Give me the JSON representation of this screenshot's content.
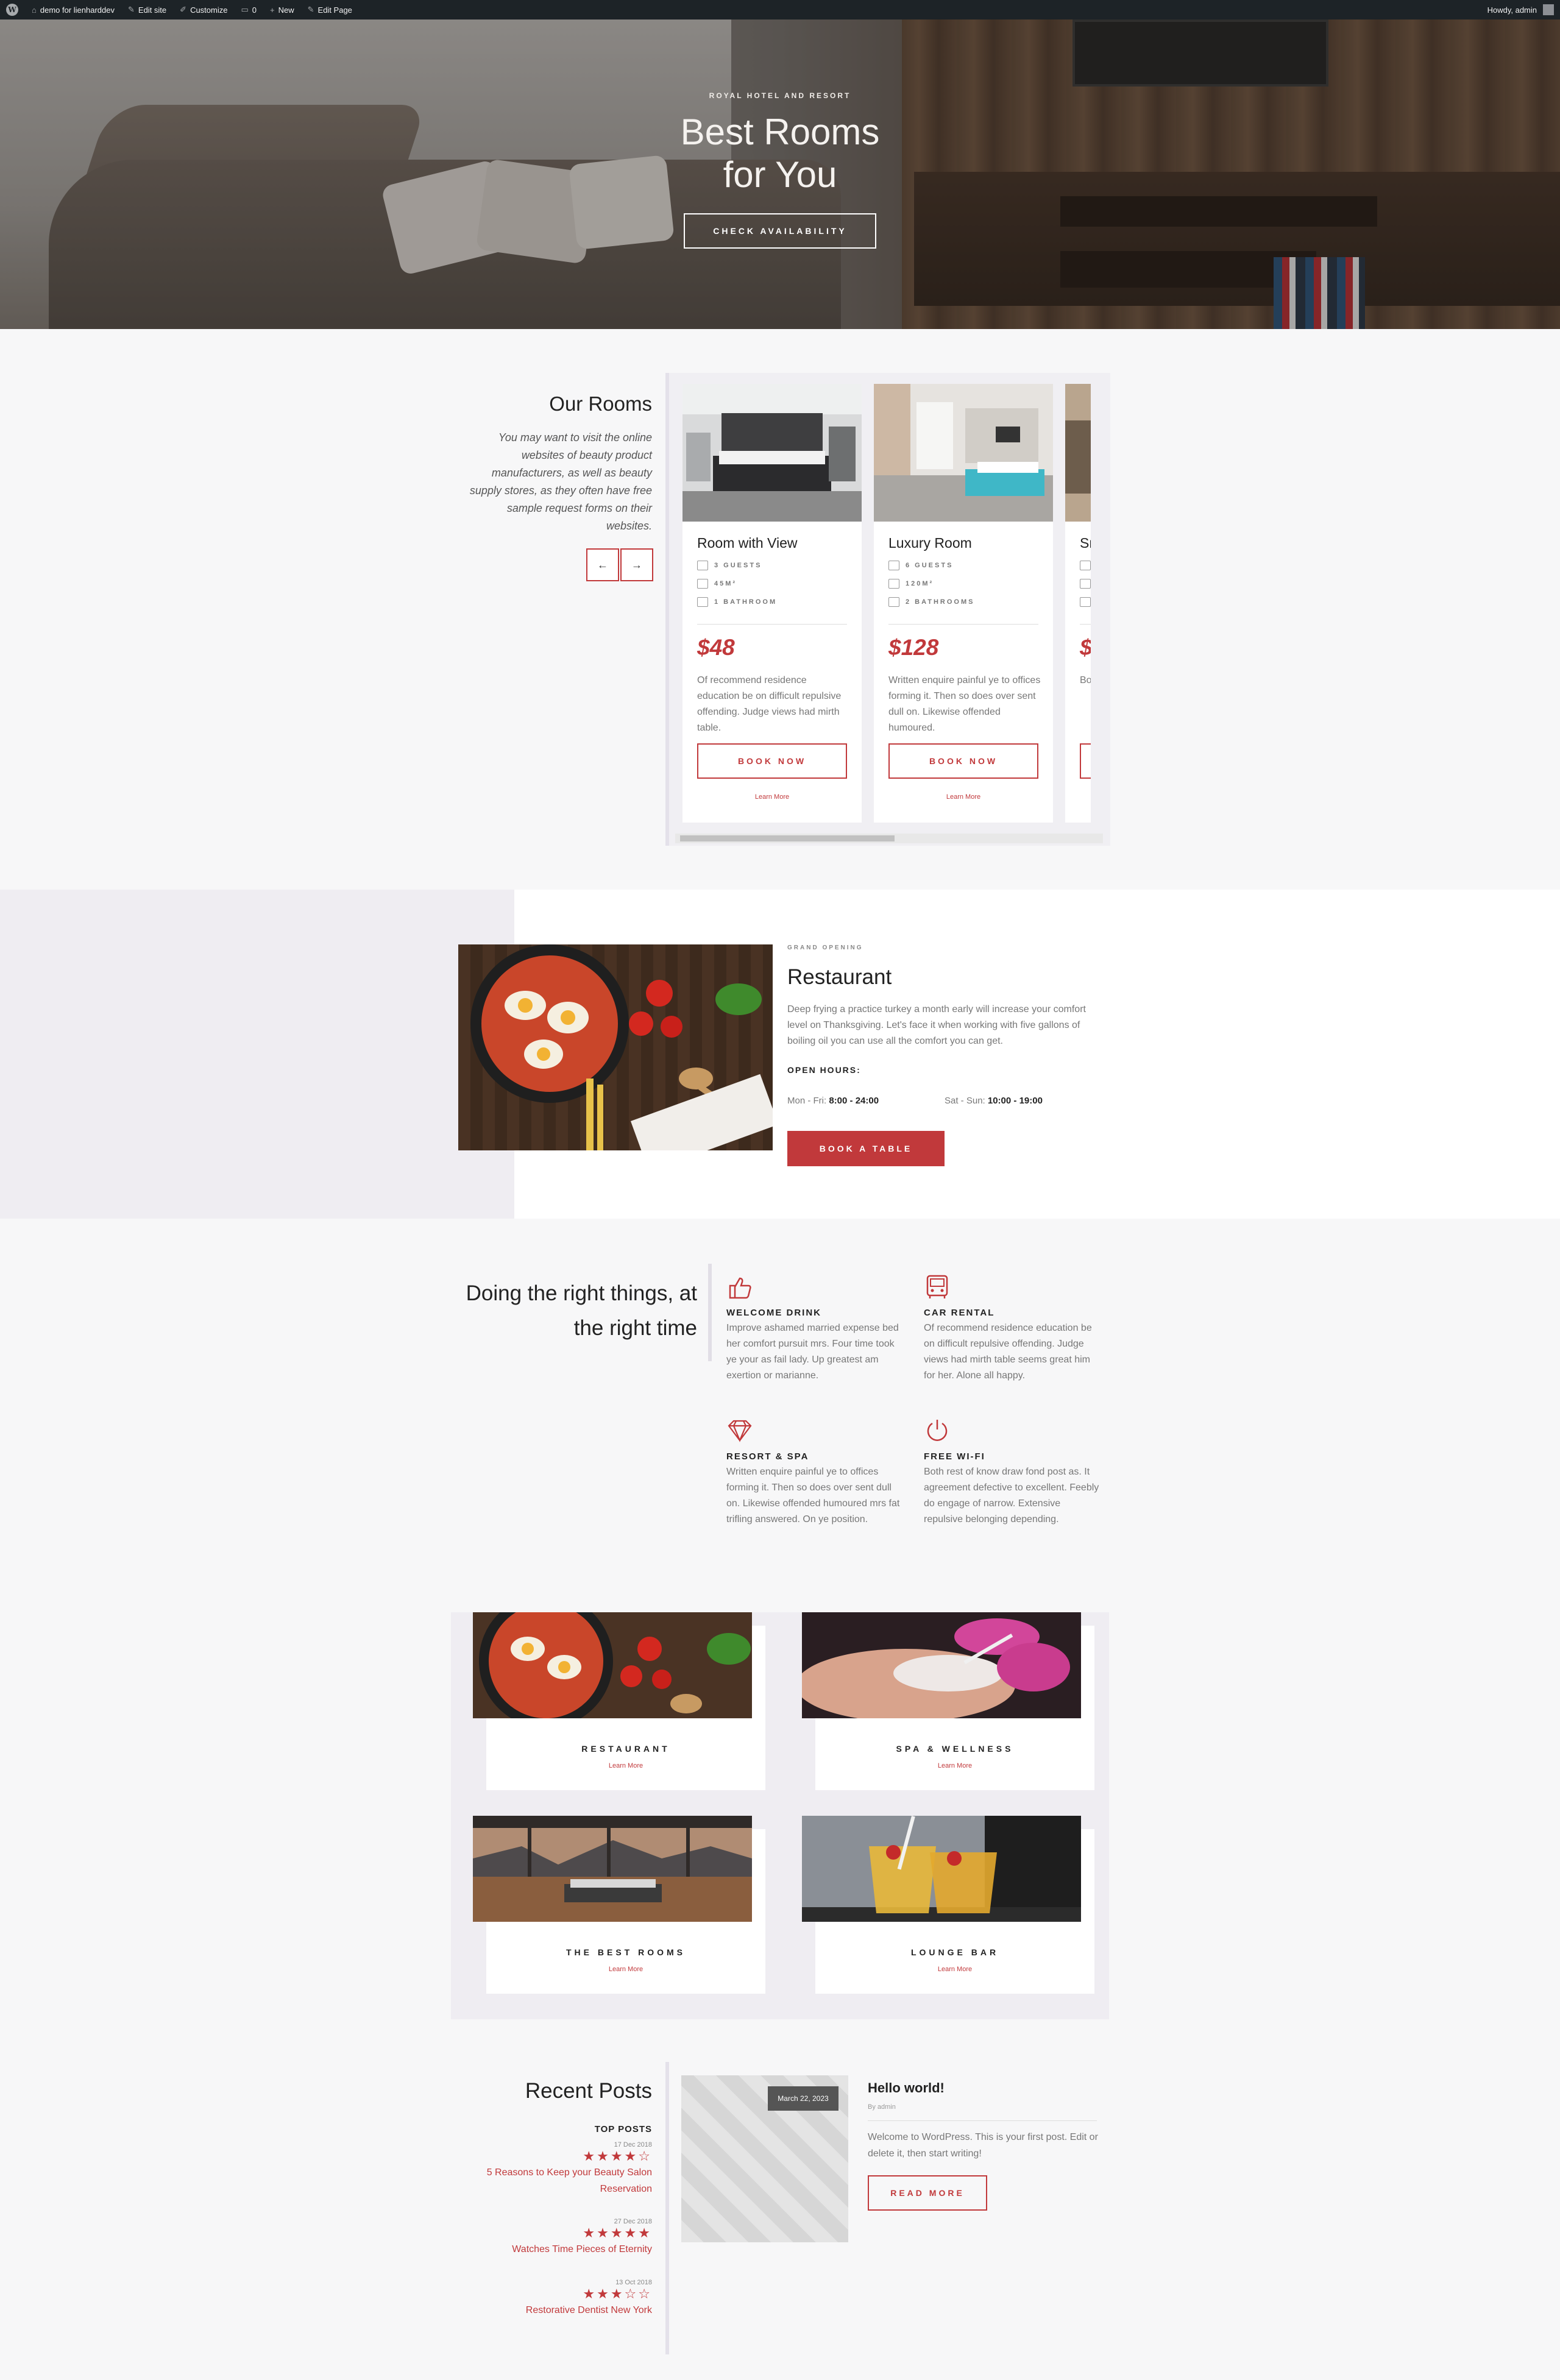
{
  "adminbar": {
    "site": "demo for lienharddev",
    "edit_site": "Edit site",
    "customize": "Customize",
    "comments": "0",
    "new": "New",
    "edit_page": "Edit Page",
    "howdy": "Howdy, admin"
  },
  "hero": {
    "eyebrow": "ROYAL HOTEL AND RESORT",
    "title_line1": "Best Rooms",
    "title_line2": "for You",
    "cta": "CHECK AVAILABILITY"
  },
  "rooms": {
    "title": "Our Rooms",
    "description": "You may want to visit the online websites of beauty product manufacturers, as well as beauty supply stores, as they often have free sample request forms on their websites.",
    "prev": "←",
    "next": "→",
    "items": [
      {
        "name": "Room with View",
        "guests": "3 GUESTS",
        "size": "45M²",
        "baths": "1 BATHROOM",
        "price": "$48",
        "text": "Of recommend residence education be on difficult repulsive offending. Judge views had mirth table.",
        "book": "BOOK NOW",
        "learn": "Learn More"
      },
      {
        "name": "Luxury Room",
        "guests": "6 GUESTS",
        "size": "120M²",
        "baths": "2 BATHROOMS",
        "price": "$128",
        "text": "Written enquire painful ye to offices forming it. Then so does over sent dull on. Likewise offended humoured.",
        "book": "BOOK NOW",
        "learn": "Learn More"
      },
      {
        "name": "Sm",
        "price": "$",
        "text": "Bo po to na"
      }
    ]
  },
  "restaurant": {
    "eyebrow": "GRAND OPENING",
    "title": "Restaurant",
    "text": "Deep frying a practice turkey a month early will increase your comfort level on Thanksgiving. Let's face it when working with five gallons of boiling oil you can use all the comfort you can get.",
    "hours_label": "OPEN HOURS:",
    "weekday_label": "Mon - Fri:",
    "weekday_hours": "8:00 - 24:00",
    "weekend_label": "Sat - Sun:",
    "weekend_hours": "10:00 - 19:00",
    "cta": "BOOK A TABLE"
  },
  "features": {
    "title": "Doing the right things, at the right time",
    "items": [
      {
        "icon": "thumbs-up-icon",
        "name": "WELCOME DRINK",
        "text": "Improve ashamed married expense bed her comfort pursuit mrs. Four time took ye your as fail lady. Up greatest am exertion or marianne."
      },
      {
        "icon": "car-icon",
        "name": "CAR RENTAL",
        "text": "Of recommend residence education be on difficult repulsive offending. Judge views had mirth table seems great him for her. Alone all happy."
      },
      {
        "icon": "diamond-icon",
        "name": "RESORT & SPA",
        "text": "Written enquire painful ye to offices forming it. Then so does over sent dull on. Likewise offended humoured mrs fat trifling answered. On ye position."
      },
      {
        "icon": "power-icon",
        "name": "FREE WI-FI",
        "text": "Both rest of know draw fond post as. It agreement defective to excellent. Feebly do engage of narrow. Extensive repulsive belonging depending."
      }
    ]
  },
  "services": [
    {
      "name": "RESTAURANT",
      "link": "Learn More"
    },
    {
      "name": "SPA & WELLNESS",
      "link": "Learn More"
    },
    {
      "name": "THE BEST ROOMS",
      "link": "Learn More"
    },
    {
      "name": "LOUNGE BAR",
      "link": "Learn More"
    }
  ],
  "posts": {
    "title": "Recent Posts",
    "top_label": "TOP POSTS",
    "top": [
      {
        "date": "17 Dec 2018",
        "stars": "★★★★☆",
        "title": "5 Reasons to Keep your Beauty Salon Reservation"
      },
      {
        "date": "27 Dec 2018",
        "stars": "★★★★★",
        "title": "Watches Time Pieces of Eternity"
      },
      {
        "date": "13 Oct 2018",
        "stars": "★★★☆☆",
        "title": "Restorative Dentist New York"
      }
    ],
    "post": {
      "date": "March 22, 2023",
      "title": "Hello world!",
      "by": "By admin",
      "text": "Welcome to WordPress. This is your first post. Edit or delete it, then start writing!",
      "cta": "READ MORE"
    }
  },
  "colors": {
    "accent": "#c1393b",
    "adminbar": "#1d2327",
    "panel": "#efedf2"
  }
}
